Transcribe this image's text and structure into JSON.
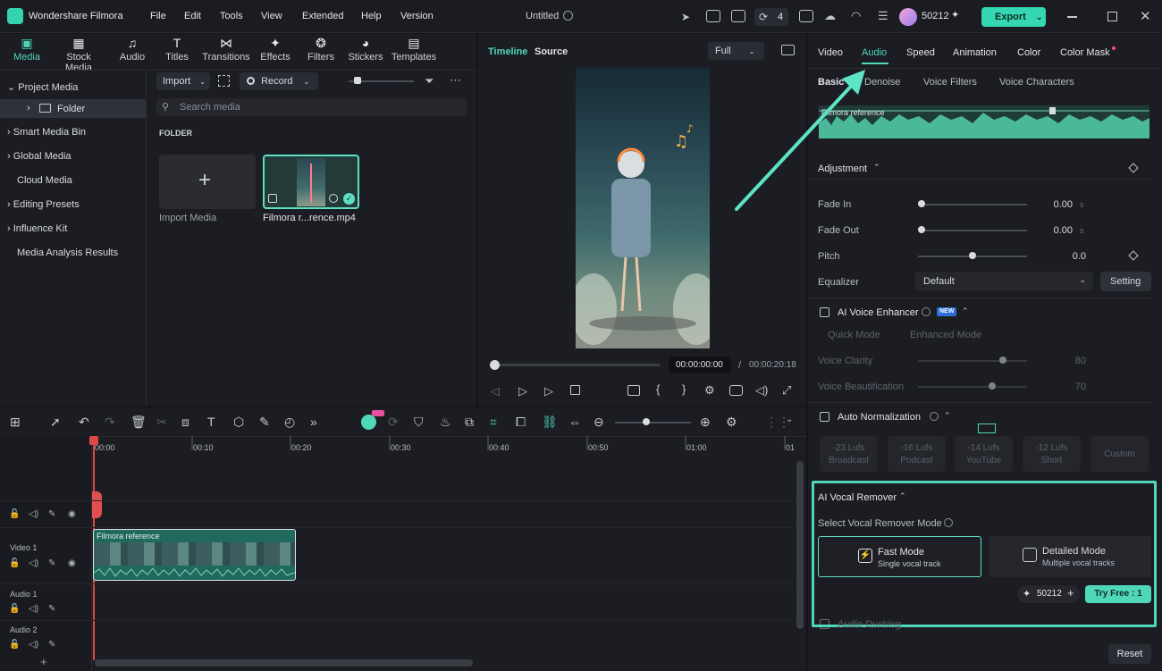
{
  "app": {
    "name": "Wondershare Filmora",
    "project_title": "Untitled",
    "count_badge": "4",
    "credits": "50212",
    "export_label": "Export"
  },
  "menu": [
    "File",
    "Edit",
    "Tools",
    "View",
    "Extended",
    "Help",
    "Version"
  ],
  "media_tabs": [
    {
      "label": "Media",
      "icon": "media-icon",
      "glyph": "▣"
    },
    {
      "label": "Stock Media",
      "icon": "stock-media-icon",
      "glyph": "▦"
    },
    {
      "label": "Audio",
      "icon": "audio-icon",
      "glyph": "♫"
    },
    {
      "label": "Titles",
      "icon": "titles-icon",
      "glyph": "T"
    },
    {
      "label": "Transitions",
      "icon": "transitions-icon",
      "glyph": "⋈"
    },
    {
      "label": "Effects",
      "icon": "effects-icon",
      "glyph": "✦"
    },
    {
      "label": "Filters",
      "icon": "filters-icon",
      "glyph": "❂"
    },
    {
      "label": "Stickers",
      "icon": "stickers-icon",
      "glyph": "◕"
    },
    {
      "label": "Templates",
      "icon": "templates-icon",
      "glyph": "▤"
    }
  ],
  "sidebar": {
    "project_media": "Project Media",
    "folder": "Folder",
    "smart_media_bin": "Smart Media Bin",
    "global_media": "Global Media",
    "cloud_media": "Cloud Media",
    "editing_presets": "Editing Presets",
    "influence_kit": "Influence Kit",
    "media_analysis": "Media Analysis Results"
  },
  "library": {
    "import_label": "Import",
    "record_label": "Record",
    "search_placeholder": "Search media",
    "folder_heading": "FOLDER",
    "import_media_label": "Import Media",
    "clip_name": "Filmora r...rence.mp4"
  },
  "player": {
    "tab_timeline": "Timeline",
    "tab_source": "Source",
    "zoom": "Full",
    "current_time": "00:00:00:00",
    "separator": "/",
    "total_time": "00:00:20:18"
  },
  "inspector": {
    "tabs": [
      "Video",
      "Audio",
      "Speed",
      "Animation",
      "Color",
      "Color Mask"
    ],
    "subtabs": [
      "Basic",
      "Denoise",
      "Voice Filters",
      "Voice Characters"
    ],
    "waveform_label": "Filmora reference",
    "adjustment": "Adjustment",
    "fade_in": {
      "label": "Fade In",
      "value": "0.00",
      "unit": "s"
    },
    "fade_out": {
      "label": "Fade Out",
      "value": "0.00",
      "unit": "s"
    },
    "pitch": {
      "label": "Pitch",
      "value": "0.0"
    },
    "equalizer": {
      "label": "Equalizer",
      "value": "Default",
      "setting": "Setting"
    },
    "ai_voice_enhancer": {
      "label": "AI Voice Enhancer",
      "badge": "NEW",
      "quick": "Quick Mode",
      "enhanced": "Enhanced Mode",
      "clarity": "Voice Clarity",
      "clarity_val": "80",
      "beautify": "Voice Beautification",
      "beautify_val": "70"
    },
    "auto_normalization": {
      "label": "Auto Normalization",
      "presets": [
        {
          "l1": "-23 Lufs",
          "l2": "Broadcast"
        },
        {
          "l1": "-16 Lufs",
          "l2": "Podcast"
        },
        {
          "l1": "-14 Lufs",
          "l2": "YouTube"
        },
        {
          "l1": "-12 Lufs",
          "l2": "Short"
        },
        {
          "l1": "Custom",
          "l2": ""
        }
      ]
    },
    "ai_vocal_remover": {
      "label": "AI Vocal Remover",
      "mode_label": "Select Vocal Remover Mode",
      "fast": "Fast Mode",
      "fast_sub": "Single vocal track",
      "detailed": "Detailed Mode",
      "detailed_sub": "Multiple vocal tracks",
      "credits": "50212",
      "try_free": "Try Free : 1"
    },
    "audio_ducking": "Audio Ducking",
    "reset": "Reset"
  },
  "timeline": {
    "ruler": [
      "00:00",
      "00:10",
      "00:20",
      "00:30",
      "00:40",
      "00:50",
      "01:00",
      "01"
    ],
    "clip_label": "Filmora reference",
    "tracks": [
      "Video 1",
      "Audio 1",
      "Audio 2"
    ]
  },
  "colors": {
    "accent": "#5ee0c4",
    "highlight_box": "#4fd8b8",
    "arrow": "#5de3c5",
    "playhead": "#e04848"
  }
}
